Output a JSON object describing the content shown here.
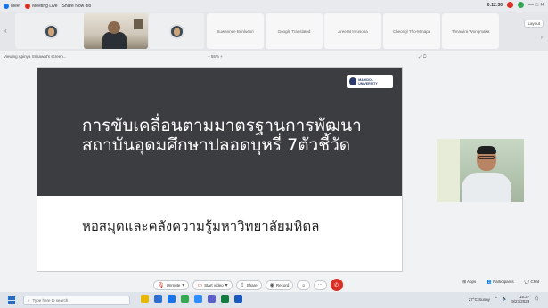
{
  "titlebar": {
    "items": [
      {
        "label": "Meet",
        "color": "#1a73e8"
      },
      {
        "label": "Meeting Live",
        "color": "#d93025"
      },
      {
        "label": "Share Now dlo",
        "color": "#888888"
      }
    ],
    "time": "0:12:30",
    "controls": "— □ ✕"
  },
  "strip": {
    "tiles": [
      {
        "label": "",
        "kind": "avatar"
      },
      {
        "label": "",
        "kind": "camera"
      },
      {
        "label": "",
        "kind": "avatar"
      },
      {
        "label": "Suwannee Bunluesri",
        "kind": "name"
      },
      {
        "label": "Google Translated",
        "kind": "name"
      },
      {
        "label": "Areerat Inrusopa",
        "kind": "name"
      },
      {
        "label": "Cheongl Tho-Mmapa",
        "kind": "name"
      },
      {
        "label": "Thnawira Wongmaka",
        "kind": "name"
      }
    ],
    "layout_label": "Layout"
  },
  "sharebar": {
    "presenter": "Viewing Apinya Srisawat's screen...",
    "zoom": "− 55% +",
    "icons": "⤢  ▢"
  },
  "slide": {
    "logo_text": "MAHIDOL UNIVERSITY",
    "title_line1": "การขับเคลื่อนตามมาตรฐานการพัฒนา",
    "title_line2": "สถาบันอุดมศึกษาปลอดบุหรี่ 7ตัวชี้วัด",
    "subtitle": "หอสมุดและคลังความรู้มหาวิทยาลัยมหิดล"
  },
  "controls": {
    "unmute": "Unmute",
    "start_video": "Start video",
    "share": "Share",
    "record": "Record",
    "reactions": "☺",
    "more": "⋯",
    "apps": "Apps",
    "participants": "Participants",
    "chat": "Chat"
  },
  "taskbar": {
    "search_placeholder": "Type here to search",
    "tray_info": "27°C Sunny",
    "clock_time": "15:27",
    "clock_date": "9/27/2023"
  }
}
